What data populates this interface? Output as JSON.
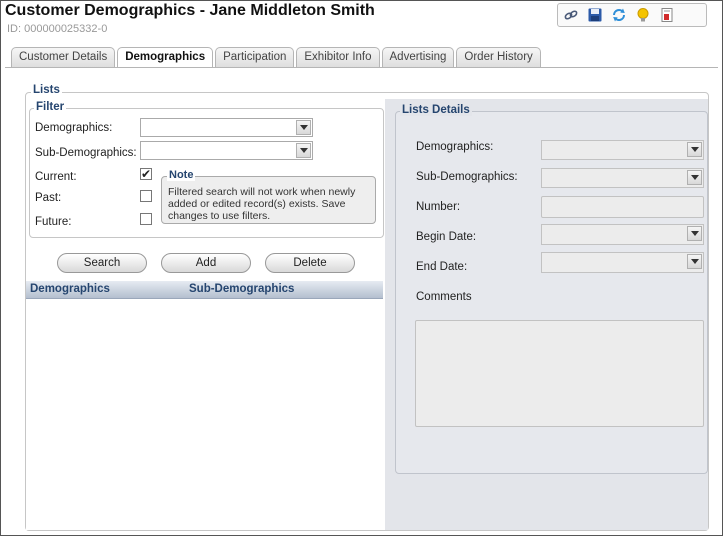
{
  "header": {
    "title": "Customer Demographics - Jane Middleton Smith",
    "subtitle": "ID: 000000025332-0"
  },
  "toolbar": {
    "icons": [
      "link-icon",
      "save-icon",
      "refresh-icon",
      "lightbulb-icon",
      "report-icon"
    ]
  },
  "tabs": [
    {
      "label": "Customer Details",
      "active": false
    },
    {
      "label": "Demographics",
      "active": true
    },
    {
      "label": "Participation",
      "active": false
    },
    {
      "label": "Exhibitor Info",
      "active": false
    },
    {
      "label": "Advertising",
      "active": false
    },
    {
      "label": "Order History",
      "active": false
    }
  ],
  "lists": {
    "legend": "Lists",
    "filter": {
      "legend": "Filter",
      "demographics_label": "Demographics:",
      "demographics_value": "",
      "subdemographics_label": "Sub-Demographics:",
      "subdemographics_value": "",
      "current_label": "Current:",
      "current_checked": true,
      "past_label": "Past:",
      "past_checked": false,
      "future_label": "Future:",
      "future_checked": false,
      "note_title": "Note",
      "note_text": "Filtered search will not work when newly added or edited record(s) exists. Save changes to use filters."
    },
    "buttons": {
      "search": "Search",
      "add": "Add",
      "delete": "Delete"
    },
    "grid": {
      "columns": [
        "Demographics",
        "Sub-Demographics"
      ],
      "rows": []
    }
  },
  "details": {
    "legend": "Lists Details",
    "demographics_label": "Demographics:",
    "subdemographics_label": "Sub-Demographics:",
    "number_label": "Number:",
    "begin_date_label": "Begin Date:",
    "end_date_label": "End Date:",
    "comments_label": "Comments"
  },
  "colors": {
    "legend_text": "#25456f",
    "right_pane_bg": "#e3e5ea"
  }
}
